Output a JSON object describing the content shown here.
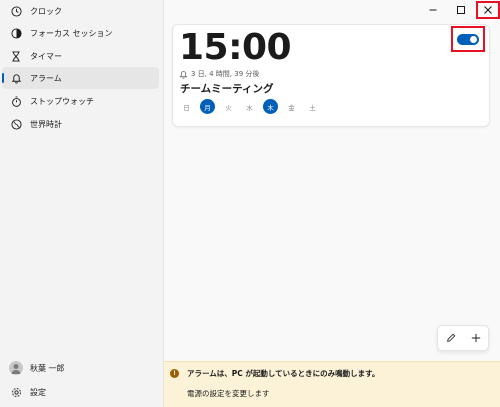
{
  "sidebar": {
    "items": [
      {
        "label": "クロック",
        "icon": "clock-icon"
      },
      {
        "label": "フォーカス セッション",
        "icon": "focus-session-icon"
      },
      {
        "label": "タイマー",
        "icon": "hourglass-icon"
      },
      {
        "label": "アラーム",
        "icon": "bell-icon",
        "selected": true
      },
      {
        "label": "ストップウォッチ",
        "icon": "stopwatch-icon"
      },
      {
        "label": "世界時計",
        "icon": "globe-icon"
      }
    ],
    "user_name": "秋葉 一郎",
    "settings_label": "設定"
  },
  "alarm": {
    "time": "15:00",
    "remaining": "3 日, 4 時間, 39 分後",
    "name": "チームミーティング",
    "enabled": true,
    "days": [
      {
        "label": "日",
        "active": false
      },
      {
        "label": "月",
        "active": true
      },
      {
        "label": "火",
        "active": false
      },
      {
        "label": "水",
        "active": false
      },
      {
        "label": "木",
        "active": true
      },
      {
        "label": "金",
        "active": false
      },
      {
        "label": "土",
        "active": false
      }
    ]
  },
  "info_bar": {
    "message": "アラームは、PC が起動しているときにのみ鳴動します。",
    "link": "電源の設定を変更します"
  },
  "colors": {
    "accent": "#005fb8",
    "highlight_outline": "#e81123",
    "info_background": "#fcf2d7"
  }
}
